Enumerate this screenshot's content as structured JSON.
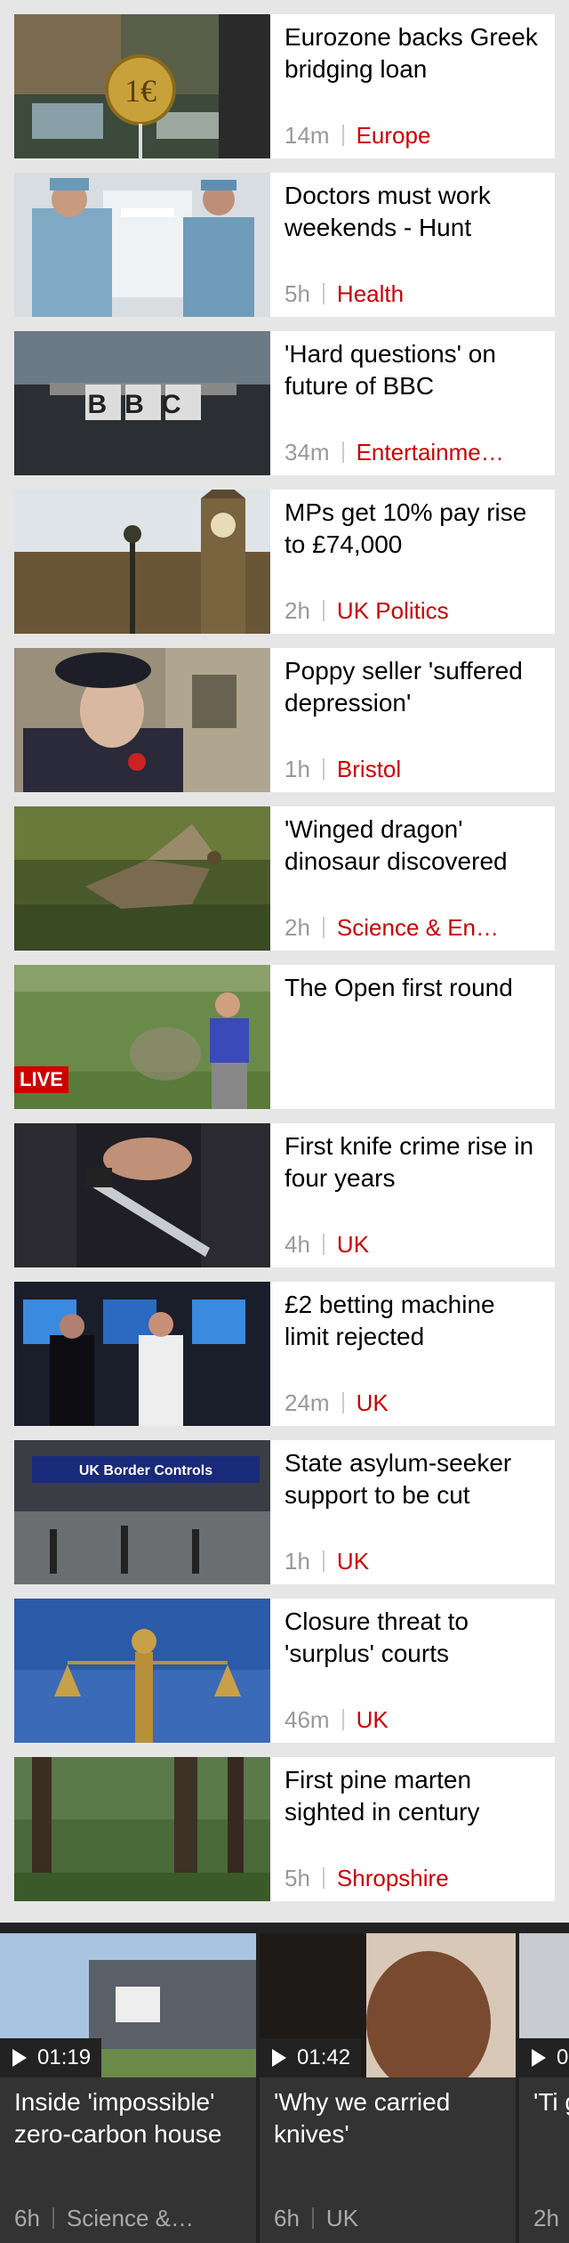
{
  "stories": [
    {
      "headline": "Eurozone backs Greek bridging loan",
      "time": "14m",
      "section": "Europe"
    },
    {
      "headline": "Doctors must work weekends - Hunt",
      "time": "5h",
      "section": "Health"
    },
    {
      "headline": "'Hard questions' on future of BBC",
      "time": "34m",
      "section": "Entertainme…"
    },
    {
      "headline": "MPs get 10% pay rise to £74,000",
      "time": "2h",
      "section": "UK Politics"
    },
    {
      "headline": "Poppy seller 'suffered depression'",
      "time": "1h",
      "section": "Bristol"
    },
    {
      "headline": "'Winged dragon' dinosaur discovered",
      "time": "2h",
      "section": "Science & En…"
    },
    {
      "headline": "The Open first round",
      "time": "",
      "section": "",
      "live_label": "LIVE"
    },
    {
      "headline": "First knife crime rise in four years",
      "time": "4h",
      "section": "UK"
    },
    {
      "headline": "£2 betting machine limit rejected",
      "time": "24m",
      "section": "UK"
    },
    {
      "headline": "State asylum-seeker support to be cut",
      "time": "1h",
      "section": "UK"
    },
    {
      "headline": "Closure threat to 'surplus' courts",
      "time": "46m",
      "section": "UK"
    },
    {
      "headline": "First pine marten sighted in century",
      "time": "5h",
      "section": "Shropshire"
    }
  ],
  "thumb_texts": {
    "coin": "1€",
    "bbc": "BBC",
    "uk_border": "UK Border Controls"
  },
  "videos": [
    {
      "duration": "01:19",
      "title": "Inside 'impossible' zero-carbon house",
      "time": "6h",
      "section": "Science &…"
    },
    {
      "duration": "01:42",
      "title": "'Why we carried knives'",
      "time": "6h",
      "section": "UK"
    },
    {
      "duration": "0",
      "title": "'Ti get",
      "time": "2h",
      "section": ""
    }
  ],
  "colors": {
    "accent": "#cc0000",
    "background": "#e6e6e6",
    "card": "#ffffff",
    "video_bg": "#222222"
  }
}
